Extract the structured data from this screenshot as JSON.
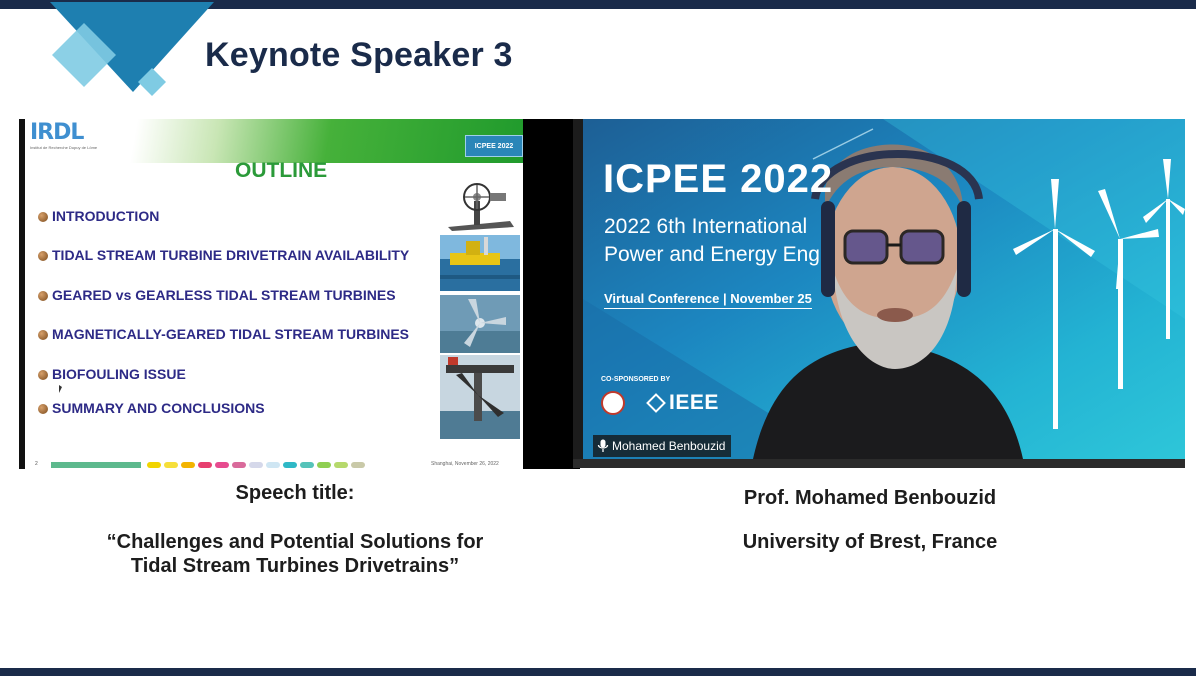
{
  "page": {
    "title": "Keynote Speaker 3"
  },
  "slide": {
    "logo": "IRDL",
    "logo_sub": "Institut de Recherche Dupuy de Lôme",
    "badge": "ICPEE 2022",
    "heading": "OUTLINE",
    "items": [
      "INTRODUCTION",
      "TIDAL STREAM TURBINE DRIVETRAIN AVAILABILITY",
      "GEARED vs GEARLESS TIDAL STREAM TURBINES",
      "MAGNETICALLY-GEARED TIDAL STREAM TURBINES",
      "BIOFOULING ISSUE",
      "SUMMARY AND CONCLUSIONS"
    ],
    "page_number": "2",
    "footer_date": "Shanghai, November 26, 2022"
  },
  "video": {
    "banner_title": "ICPEE 2022",
    "banner_line1": "2022 6th International",
    "banner_line2": "Power and Energy Eng",
    "banner_virtual": "Virtual Conference | November 25",
    "cosponsored": "CO-SPONSORED BY",
    "ieee": "IEEE",
    "participant_name": "Mohamed Benbouzid"
  },
  "speech": {
    "label": "Speech title:",
    "quote_line1": "“Challenges and Potential Solutions for",
    "quote_line2": "Tidal Stream Turbines Drivetrains”"
  },
  "speaker": {
    "name": "Prof. Mohamed Benbouzid",
    "affiliation": "University of Brest, France"
  },
  "colors": {
    "navy": "#1a2b4a",
    "teal": "#1e88b8",
    "outline_green": "#2b9a39",
    "outline_text": "#2d2a86"
  }
}
